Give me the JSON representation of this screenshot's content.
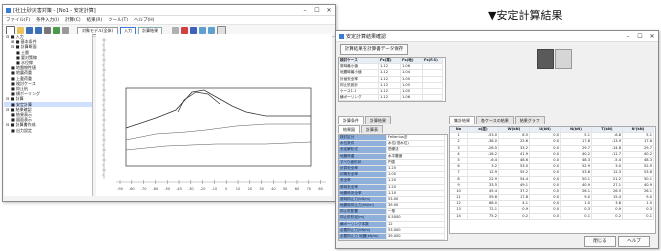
{
  "caption": "▼安定計算結果",
  "left_window": {
    "title": "[社]土砂災害対策 - [No1 - 安定計算]",
    "menu": [
      "ファイル(F)",
      "条件入力(I)",
      "計算(C)",
      "結果(R)",
      "ツール(T)",
      "ヘルプ(H)"
    ],
    "toolbar_select": "対象モデル(全体)",
    "toolbar_buttons": [
      "入力",
      "計算結果"
    ],
    "tree": [
      {
        "text": "⊟ ■ 入力",
        "level": 0
      },
      {
        "text": "⊞ ■ 基本条件",
        "level": 1
      },
      {
        "text": "⊟ ■ 計算断面",
        "level": 1
      },
      {
        "text": "■ 土層",
        "level": 2
      },
      {
        "text": "■ 要対策線",
        "level": 2
      },
      {
        "text": "■ 水位線",
        "level": 2
      },
      {
        "text": "■ 地盤物性値",
        "level": 1
      },
      {
        "text": "■ 地震荷重",
        "level": 1
      },
      {
        "text": "■ 上載荷重",
        "level": 1
      },
      {
        "text": "■ 検討ケース",
        "level": 1
      },
      {
        "text": "■ 抑止杭",
        "level": 1
      },
      {
        "text": "■ 横ボーリング",
        "level": 1
      },
      {
        "text": "⊟ ■ 計算",
        "level": 0
      },
      {
        "text": "■ 安定計算",
        "level": 1,
        "selected": true
      },
      {
        "text": "⊟ ■ 結果確認",
        "level": 0
      },
      {
        "text": "■ 結果表示",
        "level": 1
      },
      {
        "text": "■ 図面表示",
        "level": 1
      },
      {
        "text": "⊟ ■ 計算書作成",
        "level": 0
      },
      {
        "text": "■ 出力設定",
        "level": 1
      }
    ],
    "ruler_labels": [
      "-90",
      "-80",
      "-70",
      "-60",
      "-50",
      "-40",
      "-30",
      "-20",
      "-10",
      "0",
      "10",
      "20",
      "30",
      "40",
      "50",
      "60",
      "70",
      "80"
    ]
  },
  "right_window": {
    "title": "安定計算結果確認",
    "top_button": "計算結果を計算書データ保存",
    "summary_headers": [
      "検討ケース",
      "Fs(常)",
      "Fs(地)",
      "Fs(F.S)"
    ],
    "summary_rows": [
      [
        "常時最小値",
        "1.12",
        "1.06",
        ""
      ],
      [
        "地震時最小値",
        "1.12",
        "1.04",
        ""
      ],
      [
        "計画安全率",
        "1.12",
        "1.00",
        ""
      ],
      [
        "抑止杭設計",
        "1.12",
        "1.05",
        ""
      ],
      [
        "ケース1-1",
        "1.12",
        "1.00",
        ""
      ],
      [
        "横ボーリング",
        "1.12",
        "1.06",
        ""
      ]
    ],
    "left_tabs": [
      "計算条件",
      "計算結果"
    ],
    "sub_tabs": [
      "結果図",
      "計算表"
    ],
    "prop_rows": [
      [
        "検討区分",
        "Fellenius法"
      ],
      [
        "水位条件",
        "水位(低水位)"
      ],
      [
        "安定解析式",
        "簡便法"
      ],
      [
        "地震荷重",
        "水平震度"
      ],
      [
        "すべり面形状",
        "円弧"
      ],
      [
        "計算安全率",
        "1.20"
      ],
      [
        "初期安全率",
        "1.00"
      ],
      [
        "安全率",
        "1.20"
      ],
      [
        "常時安全率",
        "1.20"
      ],
      [
        "地震時安全率",
        "1.10"
      ],
      [
        "常時抑止力(kN/m)",
        "53.00"
      ],
      [
        "地震時抑止力(kN/m)",
        "39.00"
      ],
      [
        "抑止杭配置",
        "一般"
      ],
      [
        "抑止杭杭径(m)",
        "0.5000"
      ],
      [
        "横ボーリング本数",
        "12"
      ],
      [
        "必要抑止力(kN/m)",
        "53.000"
      ],
      [
        "必要抑止力 地震(kN/m)",
        "39.000"
      ]
    ],
    "right_tabs": [
      "集計結果",
      "各ケースの結果",
      "結果グラフ"
    ],
    "table_headers": [
      "No",
      "α(度)",
      "W(kN)",
      "U(kN)",
      "N(kN)",
      "T(kN)",
      "N'(kN)"
    ],
    "table_rows": [
      [
        "1",
        "-53.0",
        "8.5",
        "0.0",
        "5.1",
        "-6.8",
        "5.1"
      ],
      [
        "2",
        "-38.0",
        "22.6",
        "0.0",
        "17.8",
        "-13.9",
        "17.8"
      ],
      [
        "3",
        "-26.5",
        "33.2",
        "0.0",
        "29.7",
        "-14.8",
        "29.7"
      ],
      [
        "4",
        "-16.2",
        "41.9",
        "0.0",
        "40.2",
        "-11.7",
        "40.2"
      ],
      [
        "5",
        "-6.4",
        "48.6",
        "0.0",
        "48.3",
        "-5.4",
        "48.3"
      ],
      [
        "6",
        "3.2",
        "53.0",
        "0.0",
        "52.9",
        "3.0",
        "52.9"
      ],
      [
        "7",
        "12.9",
        "55.2",
        "0.0",
        "53.8",
        "12.3",
        "53.8"
      ],
      [
        "8",
        "22.9",
        "54.4",
        "0.0",
        "50.1",
        "21.2",
        "50.1"
      ],
      [
        "9",
        "33.5",
        "49.1",
        "0.0",
        "40.9",
        "27.1",
        "40.9"
      ],
      [
        "10",
        "45.4",
        "37.2",
        "0.0",
        "26.1",
        "26.5",
        "26.1"
      ],
      [
        "11",
        "59.8",
        "17.8",
        "0.0",
        "9.0",
        "15.4",
        "9.0"
      ],
      [
        "12",
        "68.0",
        "4.1",
        "0.0",
        "1.5",
        "3.8",
        "1.5"
      ],
      [
        "13",
        "72.1",
        "0.9",
        "0.0",
        "0.3",
        "0.9",
        "0.3"
      ],
      [
        "14",
        "75.2",
        "0.2",
        "0.0",
        "0.1",
        "0.2",
        "0.1"
      ]
    ],
    "bottom_buttons": [
      "閉じる",
      "ヘルプ"
    ]
  },
  "colors": {
    "selected": "#cfe0ff",
    "label_cell": "#8fb0da",
    "swatch_dark": "#5a5a5a",
    "swatch_light": "#d6d6d6"
  }
}
